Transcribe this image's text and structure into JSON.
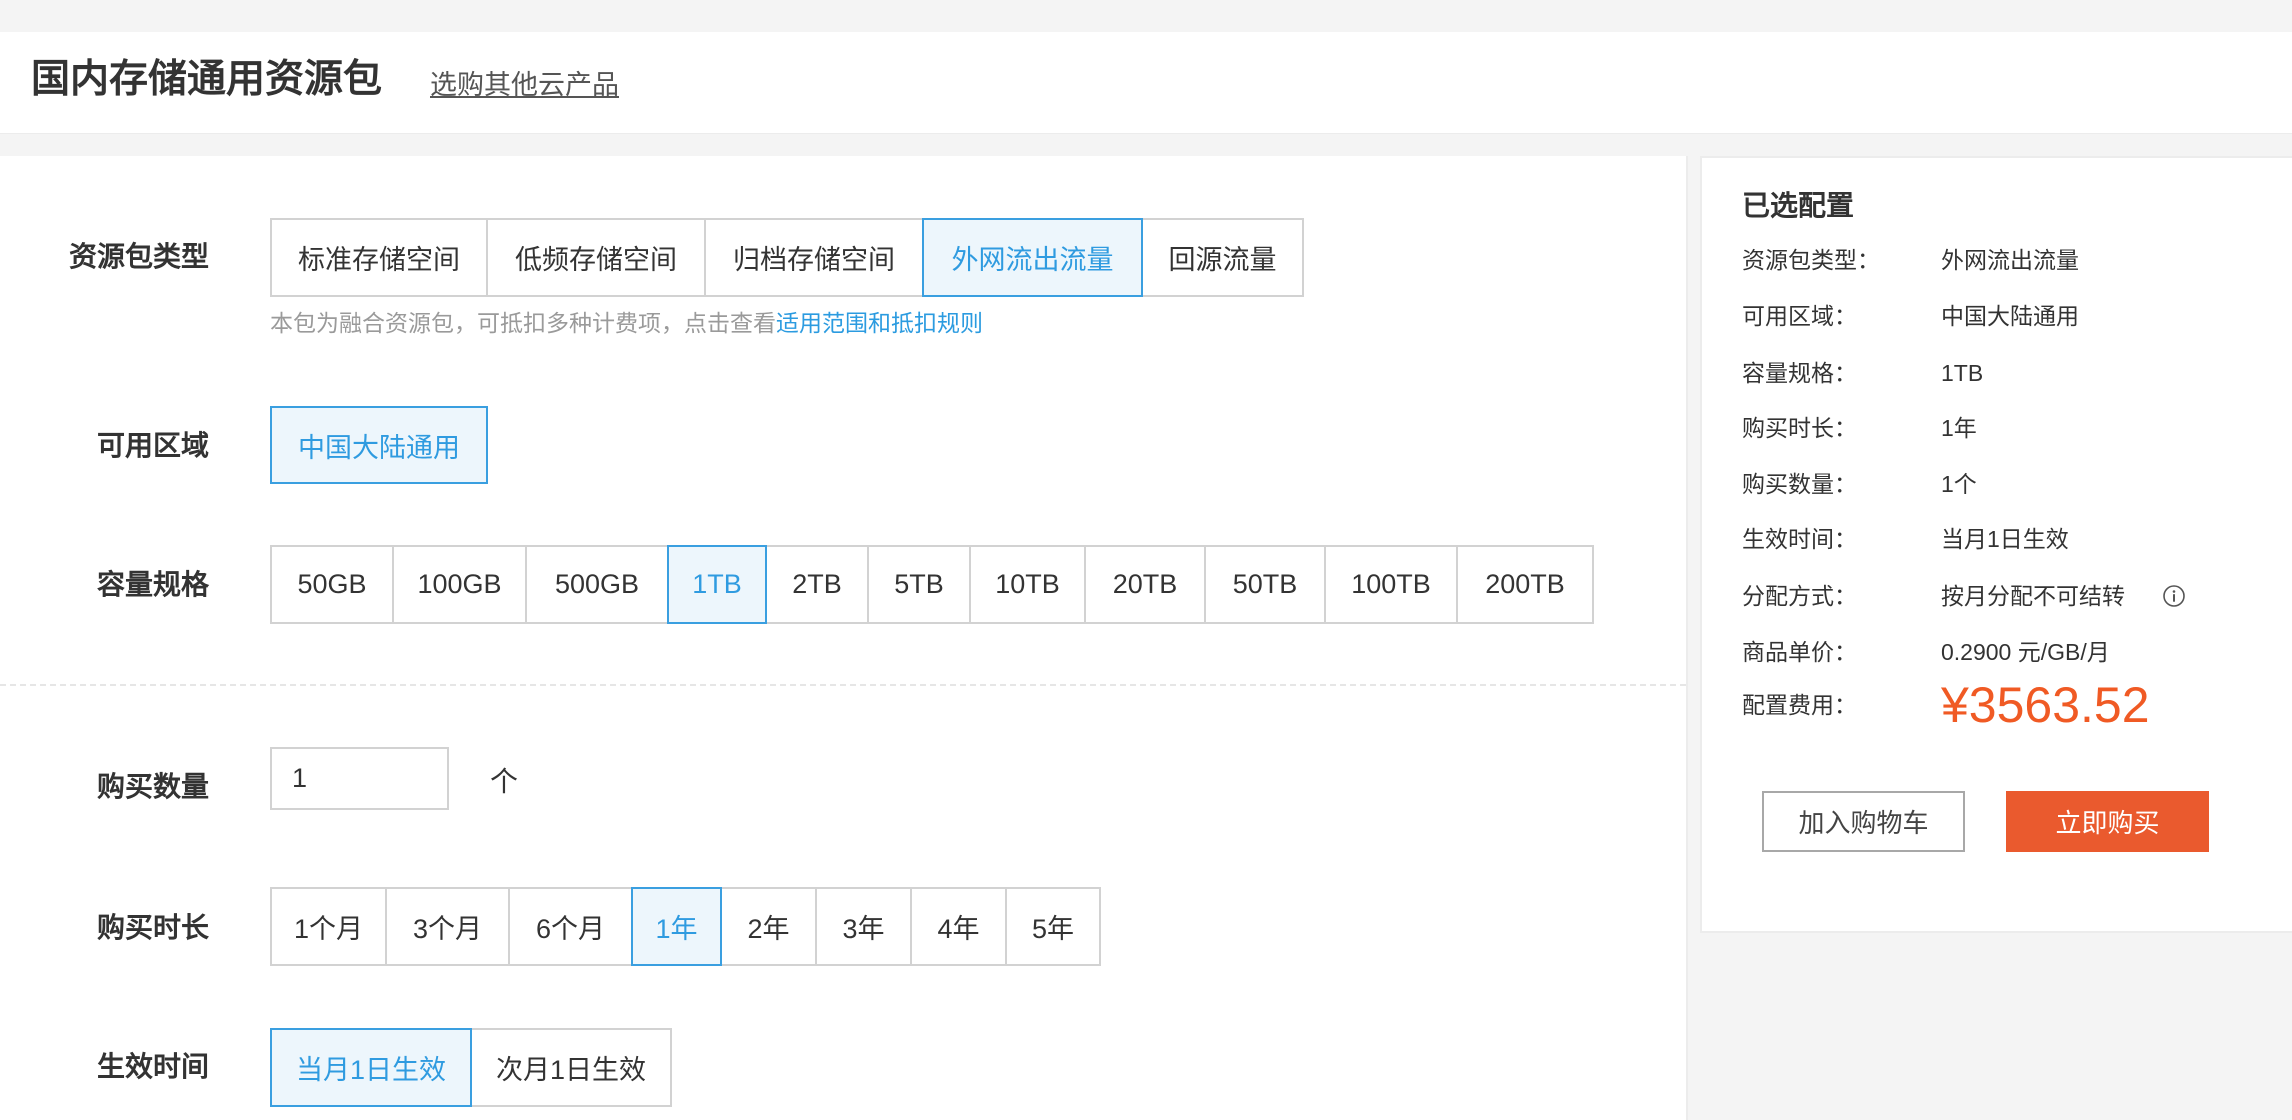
{
  "header": {
    "title": "国内存储通用资源包",
    "other_products_link": "选购其他云产品"
  },
  "form": {
    "package_type": {
      "label": "资源包类型",
      "options": [
        "标准存储空间",
        "低频存储空间",
        "归档存储空间",
        "外网流出流量",
        "回源流量"
      ],
      "selected": "外网流出流量",
      "hint": "本包为融合资源包，可抵扣多种计费项，点击查看",
      "hint_link": "适用范围和抵扣规则"
    },
    "region": {
      "label": "可用区域",
      "options": [
        "中国大陆通用"
      ],
      "selected": "中国大陆通用"
    },
    "capacity": {
      "label": "容量规格",
      "options": [
        "50GB",
        "100GB",
        "500GB",
        "1TB",
        "2TB",
        "5TB",
        "10TB",
        "20TB",
        "50TB",
        "100TB",
        "200TB"
      ],
      "selected": "1TB"
    },
    "quantity": {
      "label": "购买数量",
      "value": "1",
      "unit": "个"
    },
    "duration": {
      "label": "购买时长",
      "options": [
        "1个月",
        "3个月",
        "6个月",
        "1年",
        "2年",
        "3年",
        "4年",
        "5年"
      ],
      "selected": "1年"
    },
    "effective_time": {
      "label": "生效时间",
      "options": [
        "当月1日生效",
        "次月1日生效"
      ],
      "selected": "当月1日生效"
    }
  },
  "summary": {
    "title": "已选配置",
    "rows": [
      {
        "label": "资源包类型：",
        "value": "外网流出流量"
      },
      {
        "label": "可用区域：",
        "value": "中国大陆通用"
      },
      {
        "label": "容量规格：",
        "value": "1TB"
      },
      {
        "label": "购买时长：",
        "value": "1年"
      },
      {
        "label": "购买数量：",
        "value": "1个"
      },
      {
        "label": "生效时间：",
        "value": "当月1日生效"
      },
      {
        "label": "分配方式：",
        "value": "按月分配不可结转",
        "icon": "info-icon"
      },
      {
        "label": "商品单价：",
        "value": "0.2900 元/GB/月"
      }
    ],
    "total": {
      "label": "配置费用：",
      "value": "¥3563.52"
    },
    "add_to_cart_label": "加入购物车",
    "buy_now_label": "立即购买"
  },
  "colors": {
    "accent_blue": "#2f9be0",
    "selected_background": "#edf6fc",
    "price_orange": "#f05a24",
    "buy_button": "#ea5a2e",
    "page_background": "#f4f4f4"
  }
}
